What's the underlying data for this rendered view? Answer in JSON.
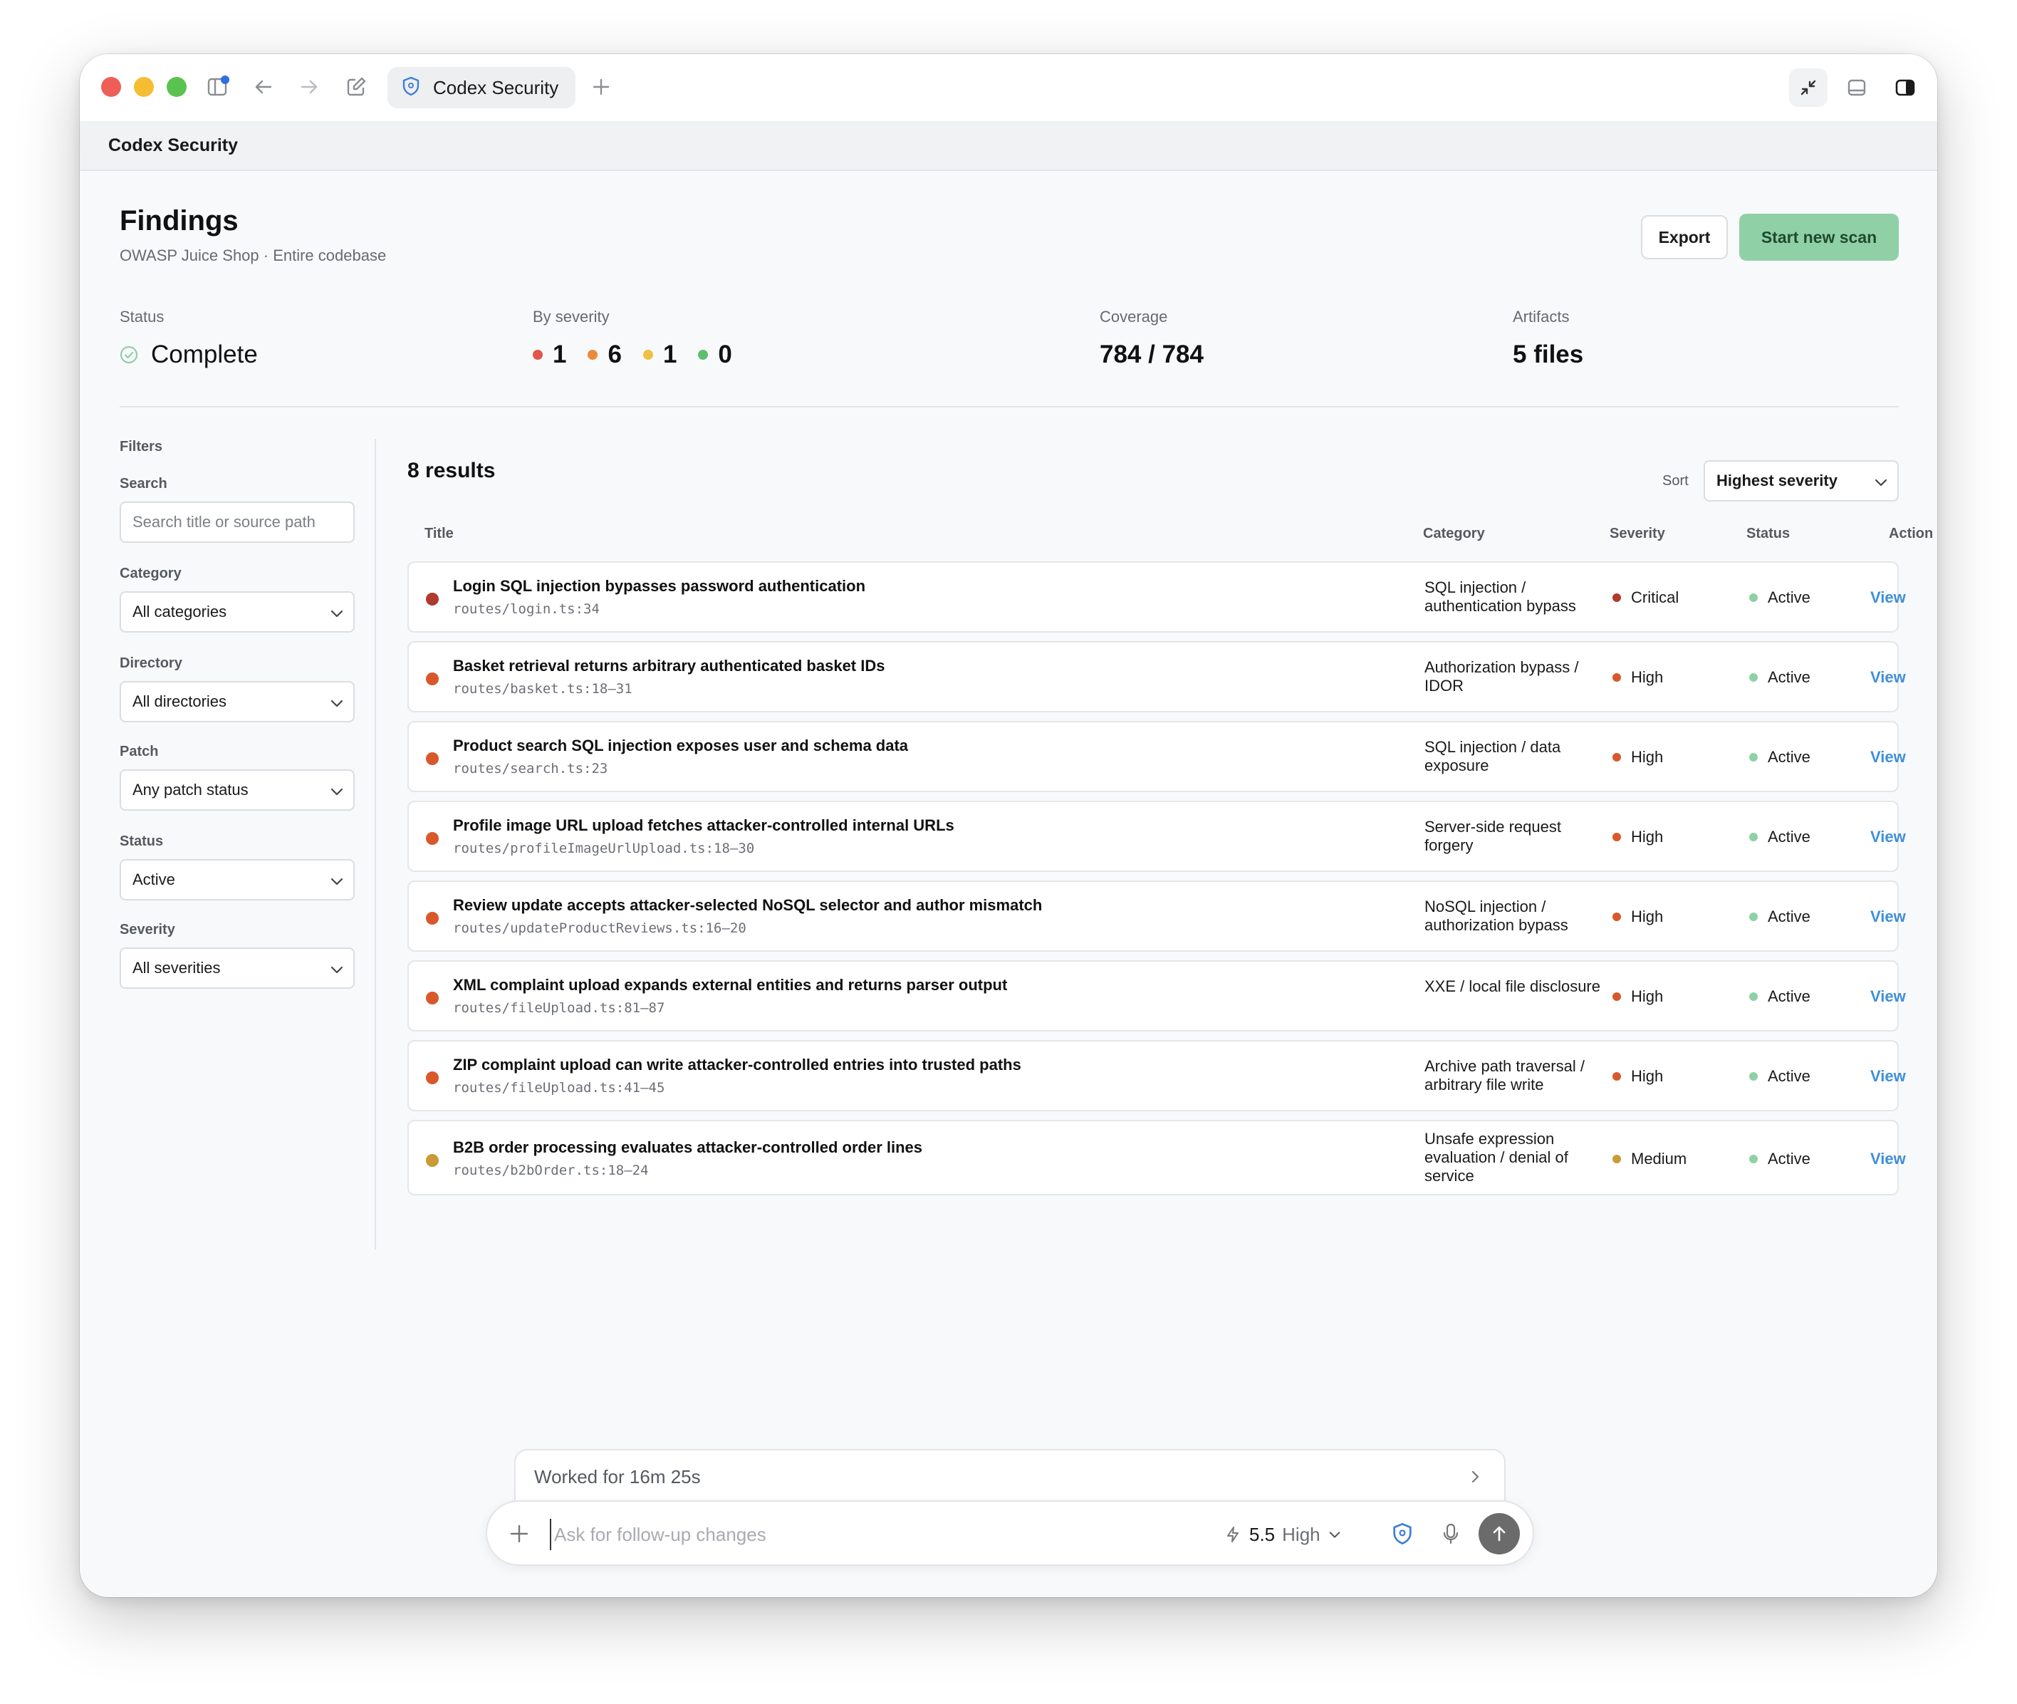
{
  "window": {
    "tab_title": "Codex Security",
    "app_title": "Codex Security"
  },
  "page": {
    "title": "Findings",
    "subtitle": "OWASP Juice Shop · Entire codebase",
    "export_label": "Export",
    "scan_label": "Start new scan"
  },
  "stats": {
    "status_label": "Status",
    "status_value": "Complete",
    "severity_label": "By severity",
    "severity_counts": [
      {
        "count": "1",
        "color": "#e0574b"
      },
      {
        "count": "6",
        "color": "#ec8a3a"
      },
      {
        "count": "1",
        "color": "#efc046"
      },
      {
        "count": "0",
        "color": "#5cbf6f"
      }
    ],
    "coverage_label": "Coverage",
    "coverage_value": "784 / 784",
    "artifacts_label": "Artifacts",
    "artifacts_value": "5 files"
  },
  "filters": {
    "heading": "Filters",
    "search_label": "Search",
    "search_placeholder": "Search title or source path",
    "category_label": "Category",
    "category_value": "All categories",
    "directory_label": "Directory",
    "directory_value": "All directories",
    "patch_label": "Patch",
    "patch_value": "Any patch status",
    "status_label": "Status",
    "status_value": "Active",
    "severity_label": "Severity",
    "severity_value": "All severities"
  },
  "results": {
    "count_label": "8 results",
    "sort_label": "Sort",
    "sort_value": "Highest severity",
    "columns": {
      "title": "Title",
      "category": "Category",
      "severity": "Severity",
      "status": "Status",
      "action": "Action"
    },
    "rows": [
      {
        "title": "Login SQL injection bypasses password authentication",
        "path": "routes/login.ts:34",
        "category": "SQL injection / authentication bypass",
        "severity": "Critical",
        "status": "Active",
        "action": "View",
        "dot_color": "#b03a2e",
        "sev_color": "#b03a2e"
      },
      {
        "title": "Basket retrieval returns arbitrary authenticated basket IDs",
        "path": "routes/basket.ts:18–31",
        "category": "Authorization bypass / IDOR",
        "severity": "High",
        "status": "Active",
        "action": "View",
        "dot_color": "#d9582b",
        "sev_color": "#d9582b"
      },
      {
        "title": "Product search SQL injection exposes user and schema data",
        "path": "routes/search.ts:23",
        "category": "SQL injection / data exposure",
        "severity": "High",
        "status": "Active",
        "action": "View",
        "dot_color": "#d9582b",
        "sev_color": "#d9582b"
      },
      {
        "title": "Profile image URL upload fetches attacker-controlled internal URLs",
        "path": "routes/profileImageUrlUpload.ts:18–30",
        "category": "Server-side request forgery",
        "severity": "High",
        "status": "Active",
        "action": "View",
        "dot_color": "#d9582b",
        "sev_color": "#d9582b"
      },
      {
        "title": "Review update accepts attacker-selected NoSQL selector and author mismatch",
        "path": "routes/updateProductReviews.ts:16–20",
        "category": "NoSQL injection / authorization bypass",
        "severity": "High",
        "status": "Active",
        "action": "View",
        "dot_color": "#d9582b",
        "sev_color": "#d9582b"
      },
      {
        "title": "XML complaint upload expands external entities and returns parser output",
        "path": "routes/fileUpload.ts:81–87",
        "category": "XXE / local file disclosure",
        "severity": "High",
        "status": "Active",
        "action": "View",
        "dot_color": "#d9582b",
        "sev_color": "#d9582b"
      },
      {
        "title": "ZIP complaint upload can write attacker-controlled entries into trusted paths",
        "path": "routes/fileUpload.ts:41–45",
        "category": "Archive path traversal / arbitrary file write",
        "severity": "High",
        "status": "Active",
        "action": "View",
        "dot_color": "#d9582b",
        "sev_color": "#d9582b"
      },
      {
        "title": "B2B order processing evaluates attacker-controlled order lines",
        "path": "routes/b2bOrder.ts:18–24",
        "category": "Unsafe expression evaluation / denial of service",
        "severity": "Medium",
        "status": "Active",
        "action": "View",
        "dot_color": "#c99a36",
        "sev_color": "#c99a36"
      }
    ]
  },
  "composer": {
    "worked_label": "Worked for 16m 25s",
    "placeholder": "Ask for follow-up changes",
    "model_version": "5.5",
    "model_effort": "High"
  }
}
